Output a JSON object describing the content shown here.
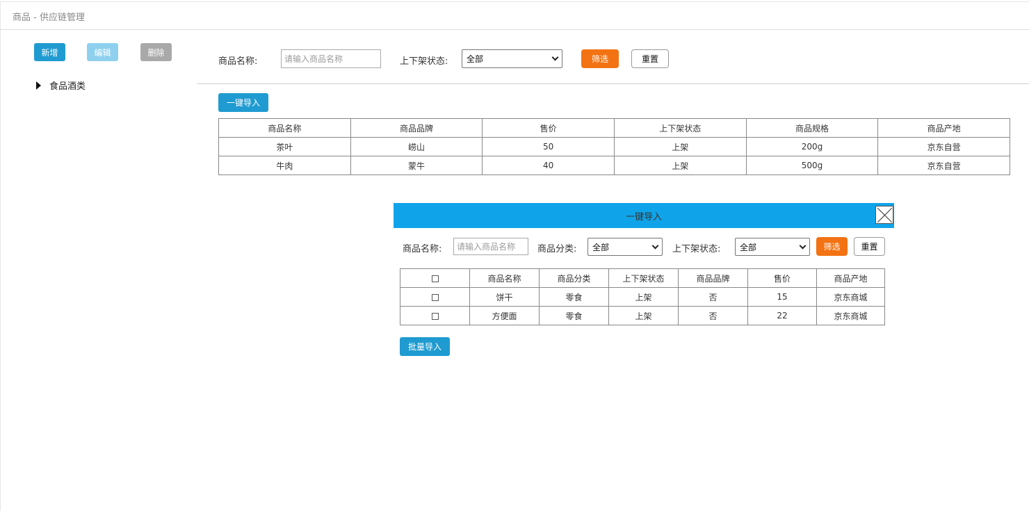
{
  "window": {
    "title": "商品 - 供应链管理"
  },
  "sidebar": {
    "add_label": "新增",
    "edit_label": "编辑",
    "delete_label": "删除",
    "tree": [
      {
        "label": "食品酒类"
      }
    ]
  },
  "filters": {
    "name_label": "商品名称:",
    "name_placeholder": "请输入商品名称",
    "status_label": "上下架状态:",
    "status_value": "全部",
    "filter_label": "筛选",
    "reset_label": "重置"
  },
  "import_button": "一键导入",
  "main_table": {
    "headers": [
      "商品名称",
      "商品品牌",
      "售价",
      "上下架状态",
      "商品规格",
      "商品产地"
    ],
    "rows": [
      [
        "茶叶",
        "崂山",
        "50",
        "上架",
        "200g",
        "京东自营"
      ],
      [
        "牛肉",
        "蒙牛",
        "40",
        "上架",
        "500g",
        "京东自营"
      ]
    ]
  },
  "modal": {
    "title": "一键导入",
    "name_label": "商品名称:",
    "name_placeholder": "请输入商品名称",
    "category_label": "商品分类:",
    "category_value": "全部",
    "status_label": "上下架状态:",
    "status_value": "全部",
    "filter_label": "筛选",
    "reset_label": "重置",
    "table": {
      "headers": [
        "商品名称",
        "商品分类",
        "上下架状态",
        "商品品牌",
        "售价",
        "商品产地"
      ],
      "rows": [
        [
          "饼干",
          "零食",
          "上架",
          "否",
          "15",
          "京东商城"
        ],
        [
          "方便面",
          "零食",
          "上架",
          "否",
          "22",
          "京东商城"
        ]
      ]
    },
    "batch_import_label": "批量导入"
  },
  "colors": {
    "primary": "#1f9bd1",
    "primary_light": "#8fd0ef",
    "disabled": "#a9a9a9",
    "filter": "#f37213",
    "modal_header": "#0fa4ea"
  }
}
